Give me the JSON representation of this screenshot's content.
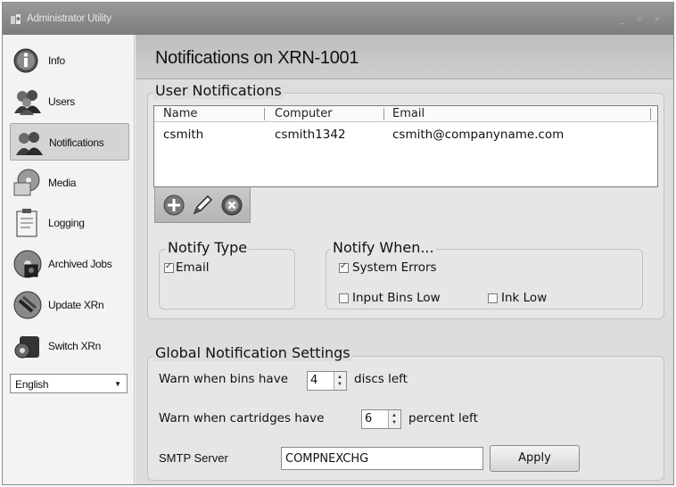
{
  "window": {
    "title": "Administrator Utility"
  },
  "sidebar": {
    "items": [
      {
        "label": "Info",
        "icon": "info-icon"
      },
      {
        "label": "Users",
        "icon": "users-icon"
      },
      {
        "label": "Notifications",
        "icon": "notifications-icon",
        "selected": true
      },
      {
        "label": "Media",
        "icon": "media-icon"
      },
      {
        "label": "Logging",
        "icon": "logging-icon"
      },
      {
        "label": "Archived Jobs",
        "icon": "archived-jobs-icon"
      },
      {
        "label": "Update XRn",
        "icon": "update-icon"
      },
      {
        "label": "Switch XRn",
        "icon": "switch-icon"
      }
    ],
    "language": {
      "selected": "English"
    }
  },
  "main": {
    "title": "Notifications on XRN-1001",
    "user_notifications": {
      "legend": "User Notifications",
      "columns": [
        "Name",
        "Computer",
        "Email"
      ],
      "rows": [
        {
          "name": "csmith",
          "computer": "csmith1342",
          "email": "csmith@companyname.com"
        }
      ],
      "toolbar": {
        "add": "add-icon",
        "edit": "edit-icon",
        "delete": "delete-icon"
      },
      "notify_type": {
        "legend": "Notify Type",
        "email": {
          "label": "Email",
          "checked": true
        }
      },
      "notify_when": {
        "legend": "Notify When...",
        "system_errors": {
          "label": "System Errors",
          "checked": true
        },
        "input_bins_low": {
          "label": "Input Bins Low",
          "checked": false
        },
        "ink_low": {
          "label": "Ink Low",
          "checked": false
        }
      }
    },
    "global_settings": {
      "legend": "Global Notification Settings",
      "bins_prefix": "Warn when bins have",
      "bins_value": "4",
      "bins_suffix": "discs left",
      "cartridges_prefix": "Warn when cartridges have",
      "cartridges_value": "6",
      "cartridges_suffix": "percent left",
      "smtp_label": "SMTP Server",
      "smtp_value": "COMPNEXCHG",
      "apply_label": "Apply"
    }
  },
  "colors": {
    "selected_nav": "#d4d4d4",
    "title_bar": "#8c8c8c",
    "header": "#c8c8c8"
  }
}
